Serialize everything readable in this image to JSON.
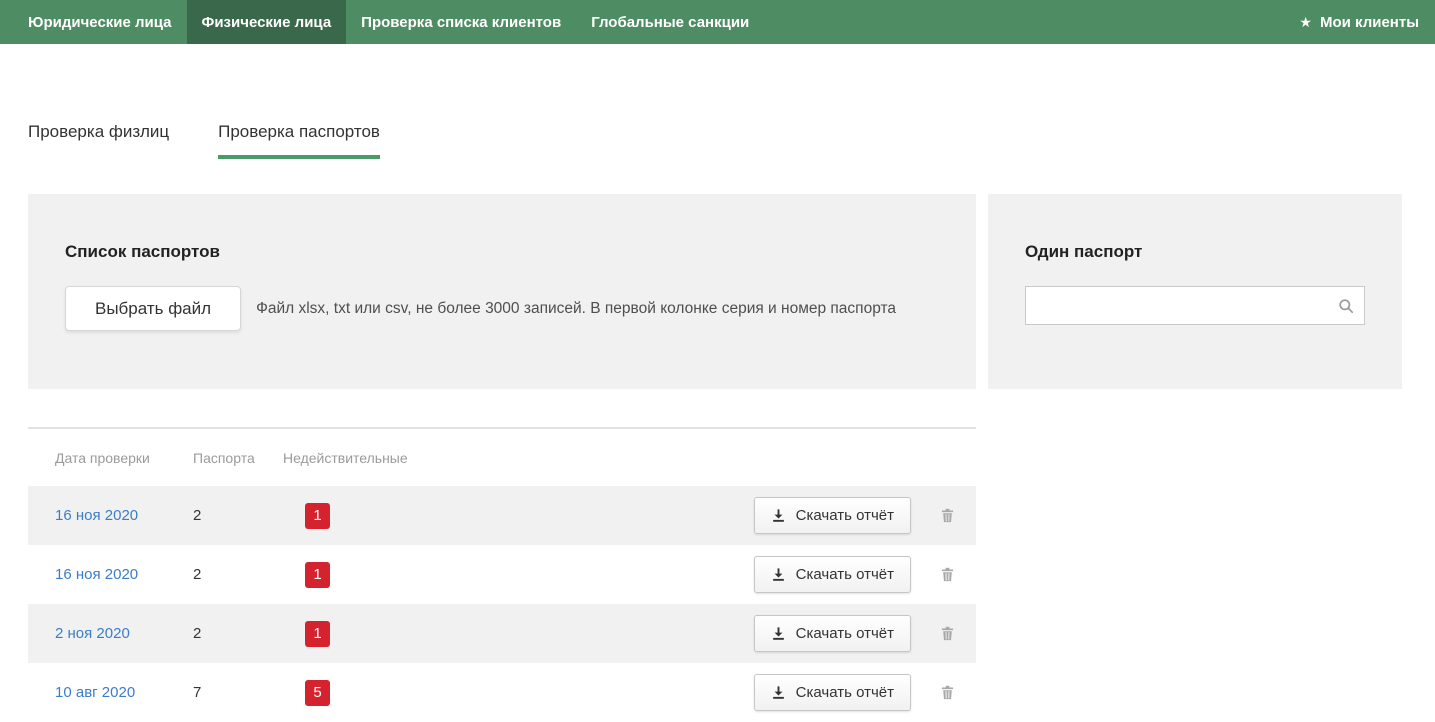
{
  "theme": {
    "nav_green": "#4e8c63",
    "nav_active_green": "#3a684a",
    "accent_green": "#4a9b68",
    "badge_red": "#d4232e",
    "link_blue": "#3b7dc8",
    "panel_gray": "#f1f1f1"
  },
  "main_nav": {
    "items": [
      {
        "label": "Юридические лица",
        "active": false
      },
      {
        "label": "Физические лица",
        "active": true
      },
      {
        "label": "Проверка списка клиентов",
        "active": false
      },
      {
        "label": "Глобальные санкции",
        "active": false
      }
    ],
    "my_clients": {
      "icon": "star-icon",
      "label": "Мои клиенты"
    }
  },
  "sub_nav": {
    "tabs": [
      {
        "label": "Проверка физлиц",
        "active": false
      },
      {
        "label": "Проверка паспортов",
        "active": true
      }
    ]
  },
  "upload_panel": {
    "title": "Список паспортов",
    "button_label": "Выбрать файл",
    "hint": "Файл xlsx, txt или csv, не более 3000 записей. В первой колонке серия и номер паспорта"
  },
  "single_panel": {
    "title": "Один паспорт",
    "search": {
      "value": "",
      "icon": "search-icon"
    }
  },
  "results_table": {
    "columns": [
      "Дата проверки",
      "Паспорта",
      "Недействительные"
    ],
    "download_label": "Скачать отчёт",
    "rows": [
      {
        "date": "16 ноя 2020",
        "passports": "2",
        "invalid": "1"
      },
      {
        "date": "16 ноя 2020",
        "passports": "2",
        "invalid": "1"
      },
      {
        "date": "2 ноя 2020",
        "passports": "2",
        "invalid": "1"
      },
      {
        "date": "10 авг 2020",
        "passports": "7",
        "invalid": "5"
      }
    ]
  }
}
